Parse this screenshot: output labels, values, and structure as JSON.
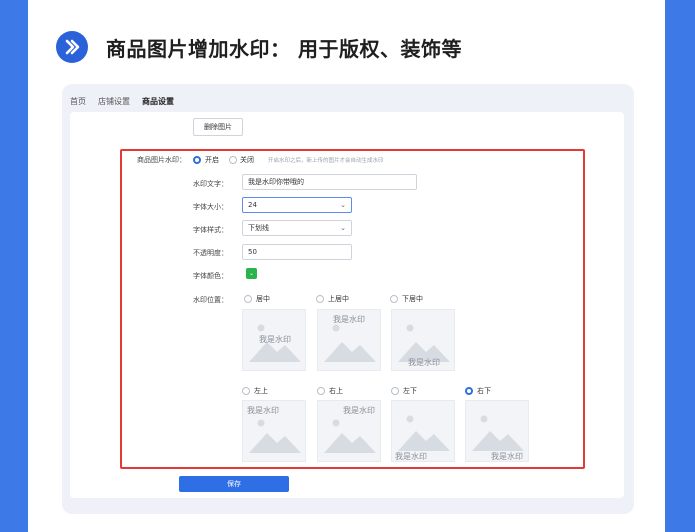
{
  "heading": {
    "title": "商品图片增加水印： 用于版权、装饰等"
  },
  "breadcrumb": {
    "items": [
      "首页",
      "店铺设置",
      "商品设置"
    ]
  },
  "delete_button": "删除图片",
  "form": {
    "watermark_label": "商品图片水印：",
    "toggle": {
      "on": "开启",
      "off": "关闭",
      "selected": "开启"
    },
    "hint": "开启水印之后，新上传的图片才会自动生成水印",
    "text_label": "水印文字：",
    "text_value": "我是水印你带哦的",
    "font_size_label": "字体大小：",
    "font_size_value": "24",
    "font_style_label": "字体样式：",
    "font_style_value": "下划线",
    "opacity_label": "不透明度：",
    "opacity_value": "50",
    "color_label": "字体颜色：",
    "color_value": "#28b44b",
    "position_label": "水印位置：",
    "positions": [
      {
        "label": "居中",
        "selected": false,
        "watermark": "我是水印"
      },
      {
        "label": "上居中",
        "selected": false,
        "watermark": "我是水印"
      },
      {
        "label": "下居中",
        "selected": false,
        "watermark": "我是水印"
      },
      {
        "label": "左上",
        "selected": false,
        "watermark": "我是水印"
      },
      {
        "label": "右上",
        "selected": false,
        "watermark": "我是水印"
      },
      {
        "label": "左下",
        "selected": false,
        "watermark": "我是水印"
      },
      {
        "label": "右下",
        "selected": true,
        "watermark": "我是水印"
      }
    ]
  },
  "save_button": "保存",
  "colors": {
    "accent": "#2e6fe6",
    "highlight": "#e53935",
    "background": "#3d7ae8"
  }
}
